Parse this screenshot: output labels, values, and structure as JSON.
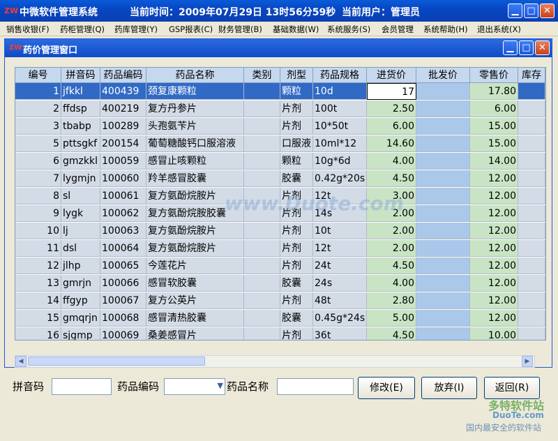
{
  "app": {
    "logo_text": "ZW",
    "title": "中微软件管理系统",
    "time_label": "当前时间：2009年07月29日  13时56分59秒",
    "user_label": "当前用户：管理员"
  },
  "menu": [
    "销售收银(F)",
    "药柜管理(Q)",
    "药库管理(Y)",
    "GSP报表(C)",
    "财务管理(B)",
    "基础数据(W)",
    "系统服务(S)",
    "会员管理",
    "系统帮助(H)",
    "退出系统(X)"
  ],
  "child_window": {
    "logo_text": "ZW",
    "title": "药价管理窗口"
  },
  "table": {
    "columns": [
      "编号",
      "拼音码",
      "药品编码",
      "药品名称",
      "类别",
      "剂型",
      "药品规格",
      "进货价",
      "批发价",
      "零售价",
      "库存"
    ],
    "rows": [
      {
        "id": "1",
        "pinyin": "jfkkl",
        "code": "400439",
        "name": "颈复康颗粒",
        "cat": "",
        "form": "颗粒",
        "spec": "10d",
        "buy": "17",
        "whole": "",
        "retail": "17.80"
      },
      {
        "id": "2",
        "pinyin": "ffdsp",
        "code": "400219",
        "name": "复方丹参片",
        "cat": "",
        "form": "片剂",
        "spec": "100t",
        "buy": "2.50",
        "whole": "",
        "retail": "6.00"
      },
      {
        "id": "3",
        "pinyin": "tbabp",
        "code": "100289",
        "name": "头孢氨苄片",
        "cat": "",
        "form": "片剂",
        "spec": "10*50t",
        "buy": "6.00",
        "whole": "",
        "retail": "15.00"
      },
      {
        "id": "5",
        "pinyin": "pttsgkf",
        "code": "200154",
        "name": "葡萄糖酸钙口服溶液",
        "cat": "",
        "form": "口服液",
        "spec": "10ml*12",
        "buy": "14.60",
        "whole": "",
        "retail": "15.00"
      },
      {
        "id": "6",
        "pinyin": "gmzkkl",
        "code": "100059",
        "name": "感冒止咳颗粒",
        "cat": "",
        "form": "颗粒",
        "spec": "10g*6d",
        "buy": "4.00",
        "whole": "",
        "retail": "14.00"
      },
      {
        "id": "7",
        "pinyin": "lygmjn",
        "code": "100060",
        "name": "羚羊感冒胶囊",
        "cat": "",
        "form": "胶囊",
        "spec": "0.42g*20s",
        "buy": "4.50",
        "whole": "",
        "retail": "12.00"
      },
      {
        "id": "8",
        "pinyin": "sl",
        "code": "100061",
        "name": "复方氨酚烷胺片",
        "cat": "",
        "form": "片剂",
        "spec": "12t",
        "buy": "3.00",
        "whole": "",
        "retail": "12.00"
      },
      {
        "id": "9",
        "pinyin": "lygk",
        "code": "100062",
        "name": "复方氨酚烷胺胶囊",
        "cat": "",
        "form": "片剂",
        "spec": "14s",
        "buy": "2.00",
        "whole": "",
        "retail": "12.00"
      },
      {
        "id": "10",
        "pinyin": "lj",
        "code": "100063",
        "name": "复方氨酚烷胺片",
        "cat": "",
        "form": "片剂",
        "spec": "10t",
        "buy": "2.00",
        "whole": "",
        "retail": "12.00"
      },
      {
        "id": "11",
        "pinyin": "dsl",
        "code": "100064",
        "name": "复方氨酚烷胺片",
        "cat": "",
        "form": "片剂",
        "spec": "12t",
        "buy": "2.00",
        "whole": "",
        "retail": "12.00"
      },
      {
        "id": "12",
        "pinyin": "jlhp",
        "code": "100065",
        "name": "今莲花片",
        "cat": "",
        "form": "片剂",
        "spec": "24t",
        "buy": "4.50",
        "whole": "",
        "retail": "12.00"
      },
      {
        "id": "13",
        "pinyin": "gmrjn",
        "code": "100066",
        "name": "感冒软胶囊",
        "cat": "",
        "form": "胶囊",
        "spec": "24s",
        "buy": "4.00",
        "whole": "",
        "retail": "12.00"
      },
      {
        "id": "14",
        "pinyin": "ffgyp",
        "code": "100067",
        "name": "复方公英片",
        "cat": "",
        "form": "片剂",
        "spec": "48t",
        "buy": "2.80",
        "whole": "",
        "retail": "12.00"
      },
      {
        "id": "15",
        "pinyin": "gmqrjn",
        "code": "100068",
        "name": "感冒清热胶囊",
        "cat": "",
        "form": "胶囊",
        "spec": "0.45g*24s",
        "buy": "5.00",
        "whole": "",
        "retail": "12.00"
      },
      {
        "id": "16",
        "pinyin": "sjgmp",
        "code": "100069",
        "name": "桑姜感冒片",
        "cat": "",
        "form": "片剂",
        "spec": "36t",
        "buy": "4.50",
        "whole": "",
        "retail": "10.00"
      }
    ]
  },
  "form": {
    "pinyin_label": "拼音码",
    "pinyin_value": "",
    "code_label": "药品编码",
    "code_value": "",
    "name_label": "药品名称",
    "name_value": ""
  },
  "buttons": {
    "modify": "修改(E)",
    "discard": "放弃(I)",
    "back": "返回(R)"
  },
  "watermarks": {
    "center": "www.Duote.com",
    "brand": "多特软件站",
    "brand_url": "DuoTe.com",
    "slogan": "国内最安全的软件站"
  },
  "colors": {
    "title_blue": "#0a48c8",
    "selected_row": "#316ac5",
    "buy_col": "#c9e4c5",
    "wholesale_col": "#a9c8ea",
    "retail_col": "#c9e4c5",
    "row_bg": "#d3dbe6"
  }
}
